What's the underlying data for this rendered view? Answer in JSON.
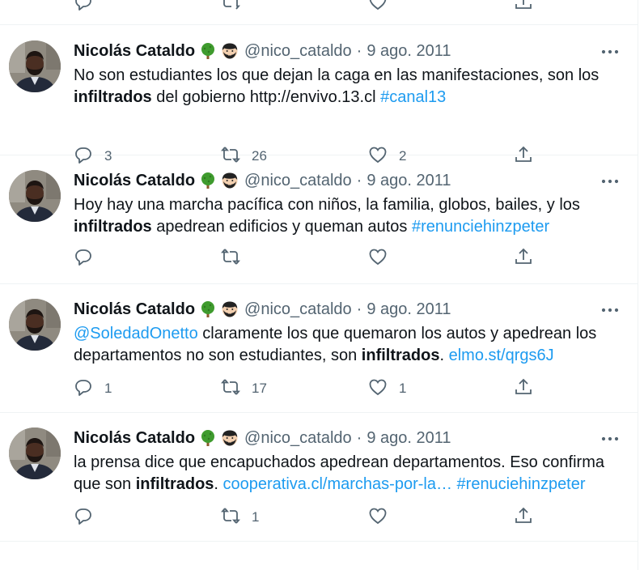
{
  "colors": {
    "link": "#1d9bf0",
    "muted": "#536471",
    "text": "#0f1419",
    "divider": "#eff3f4"
  },
  "tweets": [
    {
      "name": "Nicolás Cataldo",
      "handle": "@nico_cataldo",
      "sep": "·",
      "date": "9 ago. 2011",
      "badges": [
        "tree-emoji",
        "bearded-face-emoji"
      ],
      "text": {
        "before": "No son estudiantes los que dejan la caga en las manifestaciones, son los ",
        "bold": "infiltrados",
        "middle": " del gobierno http://envivo.13.cl ",
        "link1": "#canal13",
        "after": "",
        "link2": ""
      },
      "replies": "3",
      "retweets": "26",
      "likes": "2"
    },
    {
      "name": "Nicolás Cataldo",
      "handle": "@nico_cataldo",
      "sep": "·",
      "date": "9 ago. 2011",
      "badges": [
        "tree-emoji",
        "bearded-face-emoji"
      ],
      "text": {
        "before": "Hoy hay una marcha pacífica con niños, la familia, globos, bailes,  y los ",
        "bold": "infiltrados",
        "middle": " apedrean edificios y queman autos ",
        "link1": "#renunciehinzpeter",
        "after": "",
        "link2": ""
      },
      "replies": "",
      "retweets": "",
      "likes": ""
    },
    {
      "name": "Nicolás Cataldo",
      "handle": "@nico_cataldo",
      "sep": "·",
      "date": "9 ago. 2011",
      "badges": [
        "tree-emoji",
        "bearded-face-emoji"
      ],
      "text": {
        "mention": "@SoledadOnetto",
        "before": " claramente los que quemaron los autos y apedrean los departamentos no son estudiantes, son ",
        "bold": "infiltrados",
        "middle": ". ",
        "link1": "elmo.st/qrgs6J",
        "after": "",
        "link2": ""
      },
      "replies": "1",
      "retweets": "17",
      "likes": "1"
    },
    {
      "name": "Nicolás Cataldo",
      "handle": "@nico_cataldo",
      "sep": "·",
      "date": "9 ago. 2011",
      "badges": [
        "tree-emoji",
        "bearded-face-emoji"
      ],
      "text": {
        "before": "la prensa dice que encapuchados apedrean departamentos. Eso confirma que son ",
        "bold": "infiltrados",
        "middle": ". ",
        "link1": "cooperativa.cl/marchas-por-la…",
        "after": " ",
        "link2": "#renuciehinzpeter"
      },
      "replies": "",
      "retweets": "1",
      "likes": ""
    }
  ]
}
